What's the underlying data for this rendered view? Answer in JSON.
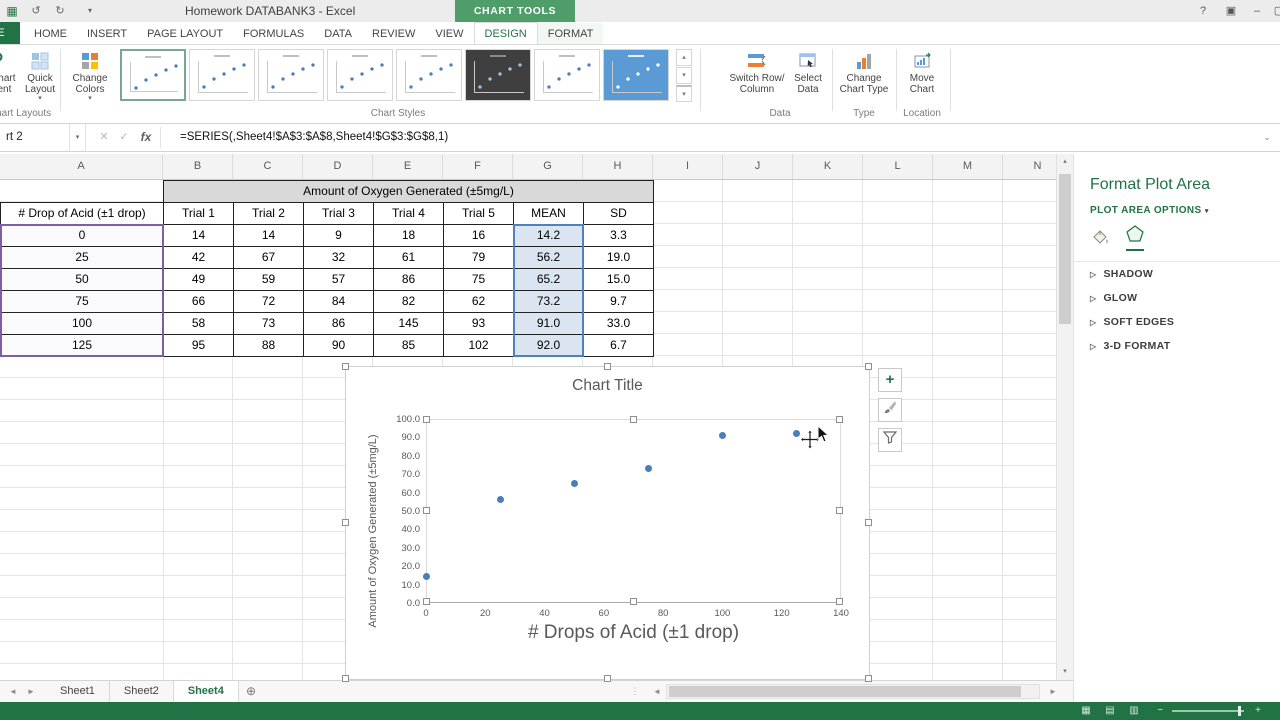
{
  "title_bar": {
    "title": "Homework DATABANK3 - Excel",
    "context_group": "CHART TOOLS"
  },
  "ribbon": {
    "file_tab": "FILE",
    "tabs": [
      "HOME",
      "INSERT",
      "PAGE LAYOUT",
      "FORMULAS",
      "DATA",
      "REVIEW",
      "VIEW",
      "DESIGN",
      "FORMAT"
    ],
    "active_tab": "DESIGN",
    "contextual_tabs": [
      "DESIGN",
      "FORMAT"
    ],
    "groups": {
      "chart_layouts": {
        "add_chart_element": "Add Chart Element",
        "quick_layout": "Quick Layout",
        "label": "Chart Layouts"
      },
      "chart_styles": {
        "change_colors": "Change Colors",
        "label": "Chart Styles",
        "styles": [
          "light",
          "light",
          "light",
          "light",
          "light",
          "dark",
          "light",
          "blue"
        ],
        "selected_index": 0
      },
      "data": {
        "switch_label": "Switch Row/ Column",
        "select_label": "Select Data",
        "label": "Data"
      },
      "type": {
        "change_type_label": "Change Chart Type",
        "label": "Type"
      },
      "location": {
        "move_chart_label": "Move Chart",
        "label": "Location"
      }
    }
  },
  "formula_bar": {
    "name_box": "rt 2",
    "formula": "=SERIES(,Sheet4!$A$3:$A$8,Sheet4!$G$3:$G$8,1)"
  },
  "grid": {
    "columns": [
      "A",
      "B",
      "C",
      "D",
      "E",
      "F",
      "G",
      "H",
      "I",
      "J",
      "K",
      "L",
      "M",
      "N"
    ],
    "merged_title": "Amount of Oxygen Generated (±5mg/L)",
    "header_row": [
      "# Drop of Acid (±1 drop)",
      "Trial 1",
      "Trial 2",
      "Trial 3",
      "Trial 4",
      "Trial 5",
      "MEAN",
      "SD"
    ],
    "rows": [
      [
        "0",
        "14",
        "14",
        "9",
        "18",
        "16",
        "14.2",
        "3.3"
      ],
      [
        "25",
        "42",
        "67",
        "32",
        "61",
        "79",
        "56.2",
        "19.0"
      ],
      [
        "50",
        "49",
        "59",
        "57",
        "86",
        "75",
        "65.2",
        "15.0"
      ],
      [
        "75",
        "66",
        "72",
        "84",
        "82",
        "62",
        "73.2",
        "9.7"
      ],
      [
        "100",
        "58",
        "73",
        "86",
        "145",
        "93",
        "91.0",
        "33.0"
      ],
      [
        "125",
        "95",
        "88",
        "90",
        "85",
        "102",
        "92.0",
        "6.7"
      ]
    ]
  },
  "chart_data": {
    "type": "scatter",
    "title": "Chart Title",
    "xlabel": "# Drops of Acid (±1 drop)",
    "ylabel": "Amount of Oxygen Generated (±5mg/L)",
    "x": [
      0,
      25,
      50,
      75,
      100,
      125
    ],
    "y": [
      14.2,
      56.2,
      65.2,
      73.2,
      91.0,
      92.0
    ],
    "xlim": [
      0,
      140
    ],
    "ylim": [
      0,
      100
    ],
    "x_ticks": [
      0,
      20,
      40,
      60,
      80,
      100,
      120,
      140
    ],
    "y_ticks": [
      "100.0",
      "90.0",
      "80.0",
      "70.0",
      "60.0",
      "50.0",
      "40.0",
      "30.0",
      "20.0",
      "10.0",
      "0.0"
    ],
    "point_color": "#4a7ebb",
    "grid": false,
    "legend": false
  },
  "format_panel": {
    "title": "Format Plot Area",
    "options_label": "PLOT AREA OPTIONS",
    "sections": [
      "SHADOW",
      "GLOW",
      "SOFT EDGES",
      "3-D FORMAT"
    ]
  },
  "sheet_bar": {
    "tabs": [
      "Sheet1",
      "Sheet2",
      "Sheet4"
    ],
    "active": "Sheet4"
  },
  "icons": {
    "app": "▦",
    "undo": "↺",
    "redo": "↻",
    "qat_menu": "▾",
    "help": "?",
    "ribbon_display": "▣",
    "minimize": "–",
    "maximize": "▢",
    "name_dropdown": "▾",
    "cancel": "✕",
    "enter": "✓",
    "fx": "fx",
    "formula_expand": "⌄",
    "gallery_up": "▴",
    "gallery_down": "▾",
    "gallery_more": "▾",
    "scroll_up": "▲",
    "scroll_down": "▼",
    "scroll_left": "◄",
    "scroll_right": "►",
    "sheet_nav_left": "◄",
    "sheet_nav_right": "►",
    "add_sheet": "⊕",
    "tab_splitter": "⋮",
    "normal_view": "▦",
    "page_layout_view": "▤",
    "page_break_view": "▥",
    "zoom_out": "−",
    "zoom_in": "+",
    "section_chevron": "▷",
    "options_dropdown": "▾",
    "plus": "+"
  },
  "colors": {
    "accent_green": "#217346",
    "context_band_green": "#4f9d69",
    "highlight_blue_border": "#4f81bd",
    "highlight_blue_fill": "#dbe5f1",
    "highlight_purple_border": "#7c5fa0",
    "point_blue": "#4a7ebb",
    "merged_title_fill": "#d9d9d9"
  }
}
